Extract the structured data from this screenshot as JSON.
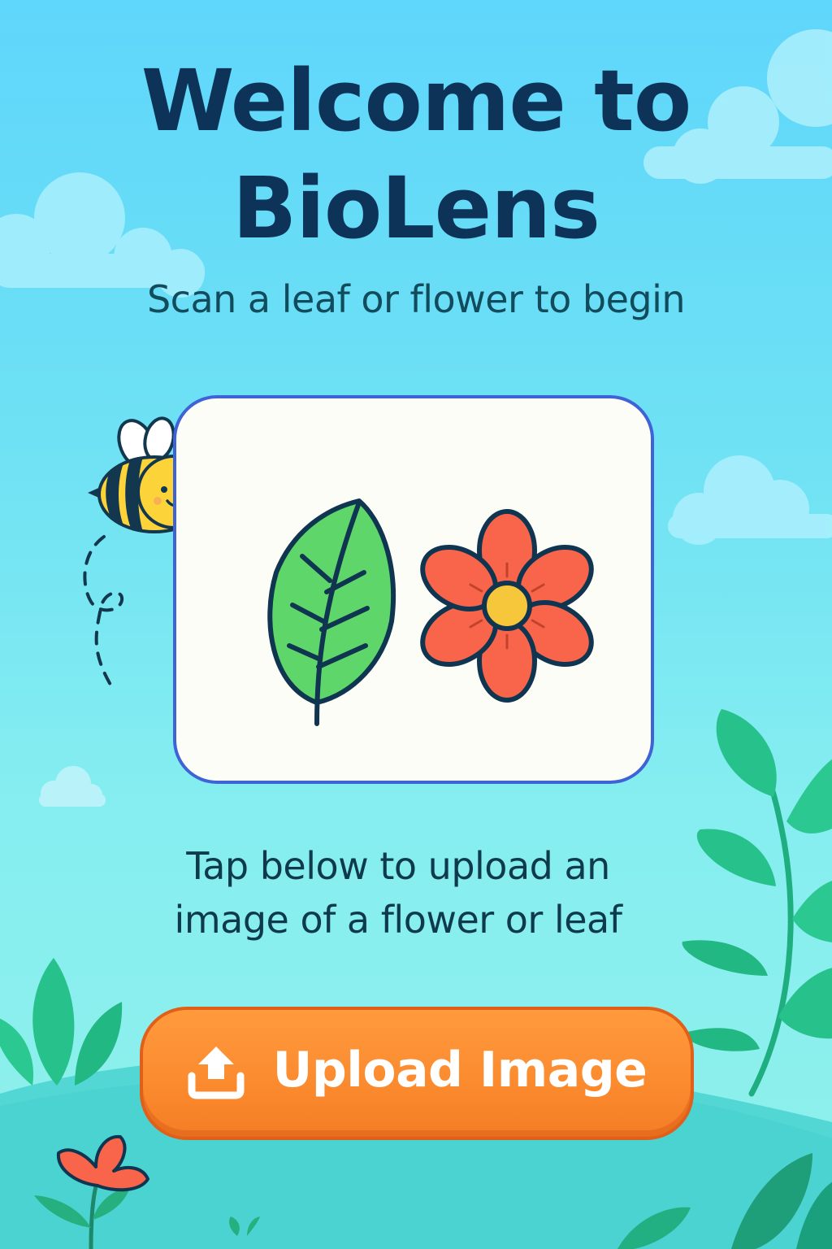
{
  "screen": {
    "title_line1": "Welcome to",
    "title_line2": "BioLens",
    "subtitle": "Scan a leaf or flower to begin",
    "instruction_line1": "Tap below to upload an",
    "instruction_line2": "image of a flower or leaf"
  },
  "upload_button": {
    "label": "Upload Image",
    "icon": "upload-icon"
  },
  "illustration": {
    "card_icons": [
      "leaf-icon",
      "flower-icon"
    ],
    "mascot": "bee-icon"
  },
  "colors": {
    "title": "#0d3358",
    "card_border": "#3f63d6",
    "button": "#fb8a2e",
    "leaf": "#5fd66a",
    "flower": "#f9654a",
    "flower_center": "#f7c73b"
  }
}
